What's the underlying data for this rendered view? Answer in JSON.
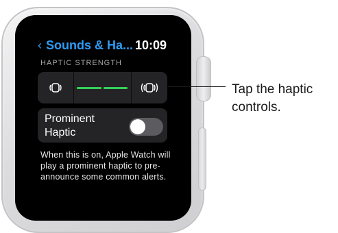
{
  "screen": {
    "back_chevron": "‹",
    "nav_title": "Sounds & Ha...",
    "clock": "10:09",
    "section_header": "HAPTIC STRENGTH",
    "haptic_level": 0.5,
    "toggle_label": "Prominent Haptic",
    "toggle_on": false,
    "description": "When this is on, Apple Watch will play a prominent haptic to pre-announce some common alerts."
  },
  "icons": {
    "decrease": "haptic-decrease-icon",
    "increase": "haptic-increase-icon"
  },
  "colors": {
    "accent": "#2f9bf5",
    "level": "#34d05a",
    "toggle_off": "#5c5c60"
  },
  "callout": {
    "text": "Tap the haptic controls."
  }
}
